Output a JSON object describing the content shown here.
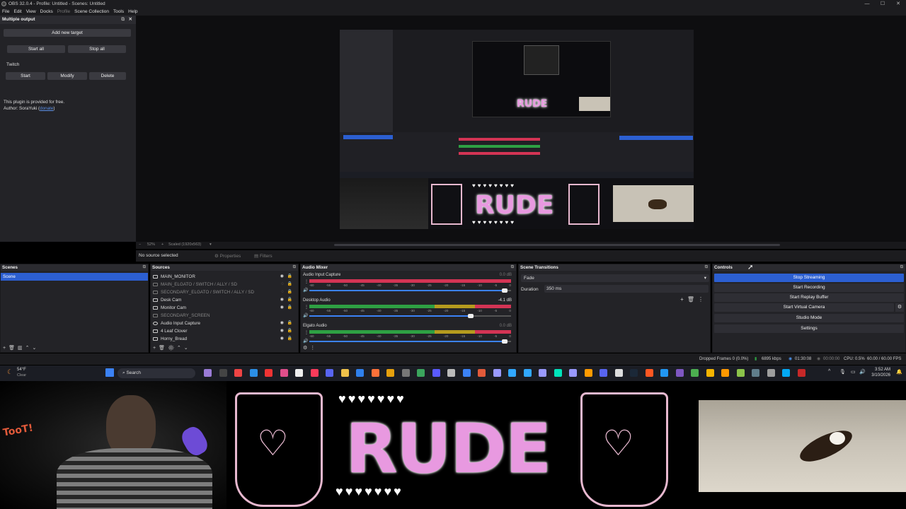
{
  "window": {
    "title": "OBS 32.0.4 - Profile: Untitled - Scenes: Untitled"
  },
  "menu": [
    "File",
    "Edit",
    "View",
    "Docks",
    "Profile",
    "Scene Collection",
    "Tools",
    "Help"
  ],
  "dock": {
    "title": "Multiple output",
    "add_target": "Add new target",
    "start_all": "Start all",
    "stop_all": "Stop all",
    "section": "Twitch",
    "start": "Start",
    "modify": "Modify",
    "delete": "Delete",
    "info1": "This plugin is provided for free.",
    "info2": "Author: SoraYuki (",
    "info_link": "donate",
    "info3": ")"
  },
  "preview_toolbar": {
    "zoom": "52%",
    "scale": "Scaled (1920x563)"
  },
  "source_bar": {
    "status": "No source selected",
    "properties": "Properties",
    "filters": "Filters"
  },
  "scenes": {
    "title": "Scenes",
    "items": [
      "Scene"
    ]
  },
  "sources": {
    "title": "Sources",
    "items": [
      "MAIN_MONITOR",
      "MAIN_ELGATO / SWITCH / ALLY / SD",
      "SECONDARY_ELGATO / SWITCH / ALLY / SD",
      "Desk Cam",
      "Monitor Cam",
      "SECONDARY_SCREEN",
      "Audio Input Capture",
      "4 Leaf Clover",
      "Horny_Bread"
    ]
  },
  "mixer": {
    "title": "Audio Mixer",
    "channels": [
      {
        "name": "Audio Input Capture",
        "db": "0.0 dB"
      },
      {
        "name": "Desktop Audio",
        "db": "-4.1 dB"
      },
      {
        "name": "Elgato Audio",
        "db": "0.0 dB"
      }
    ],
    "ticks": [
      "-60",
      "-55",
      "-50",
      "-45",
      "-40",
      "-35",
      "-30",
      "-25",
      "-20",
      "-15",
      "-10",
      "-5",
      "0"
    ]
  },
  "transitions": {
    "title": "Scene Transitions",
    "type": "Fade",
    "duration_label": "Duration",
    "duration": "350 ms"
  },
  "controls": {
    "title": "Controls",
    "stop_streaming": "Stop Streaming",
    "start_recording": "Start Recording",
    "start_replay": "Start Replay Buffer",
    "start_vcam": "Start Virtual Camera",
    "studio_mode": "Studio Mode",
    "settings": "Settings"
  },
  "status": {
    "dropped": "Dropped Frames 0 (0.0%)",
    "bitrate": "6895 kbps",
    "live_time": "01:30:08",
    "rec_time": "00:00:00",
    "cpu": "CPU: 0.5%",
    "fps": "60.00 / 60.00 FPS"
  },
  "taskbar": {
    "weather_temp": "54°F",
    "weather_desc": "Clear",
    "search": "Search",
    "time": "3:52 AM",
    "date": "3/10/2026"
  },
  "stream_overlay": {
    "brand": "RUDE",
    "sticker": "TooT!"
  },
  "colors": {
    "accent": "#2c5fd1",
    "meter_red": "#d33454",
    "meter_green": "#2ea043",
    "meter_yellow": "#b59b1e",
    "brand_pink": "#e899e0"
  }
}
